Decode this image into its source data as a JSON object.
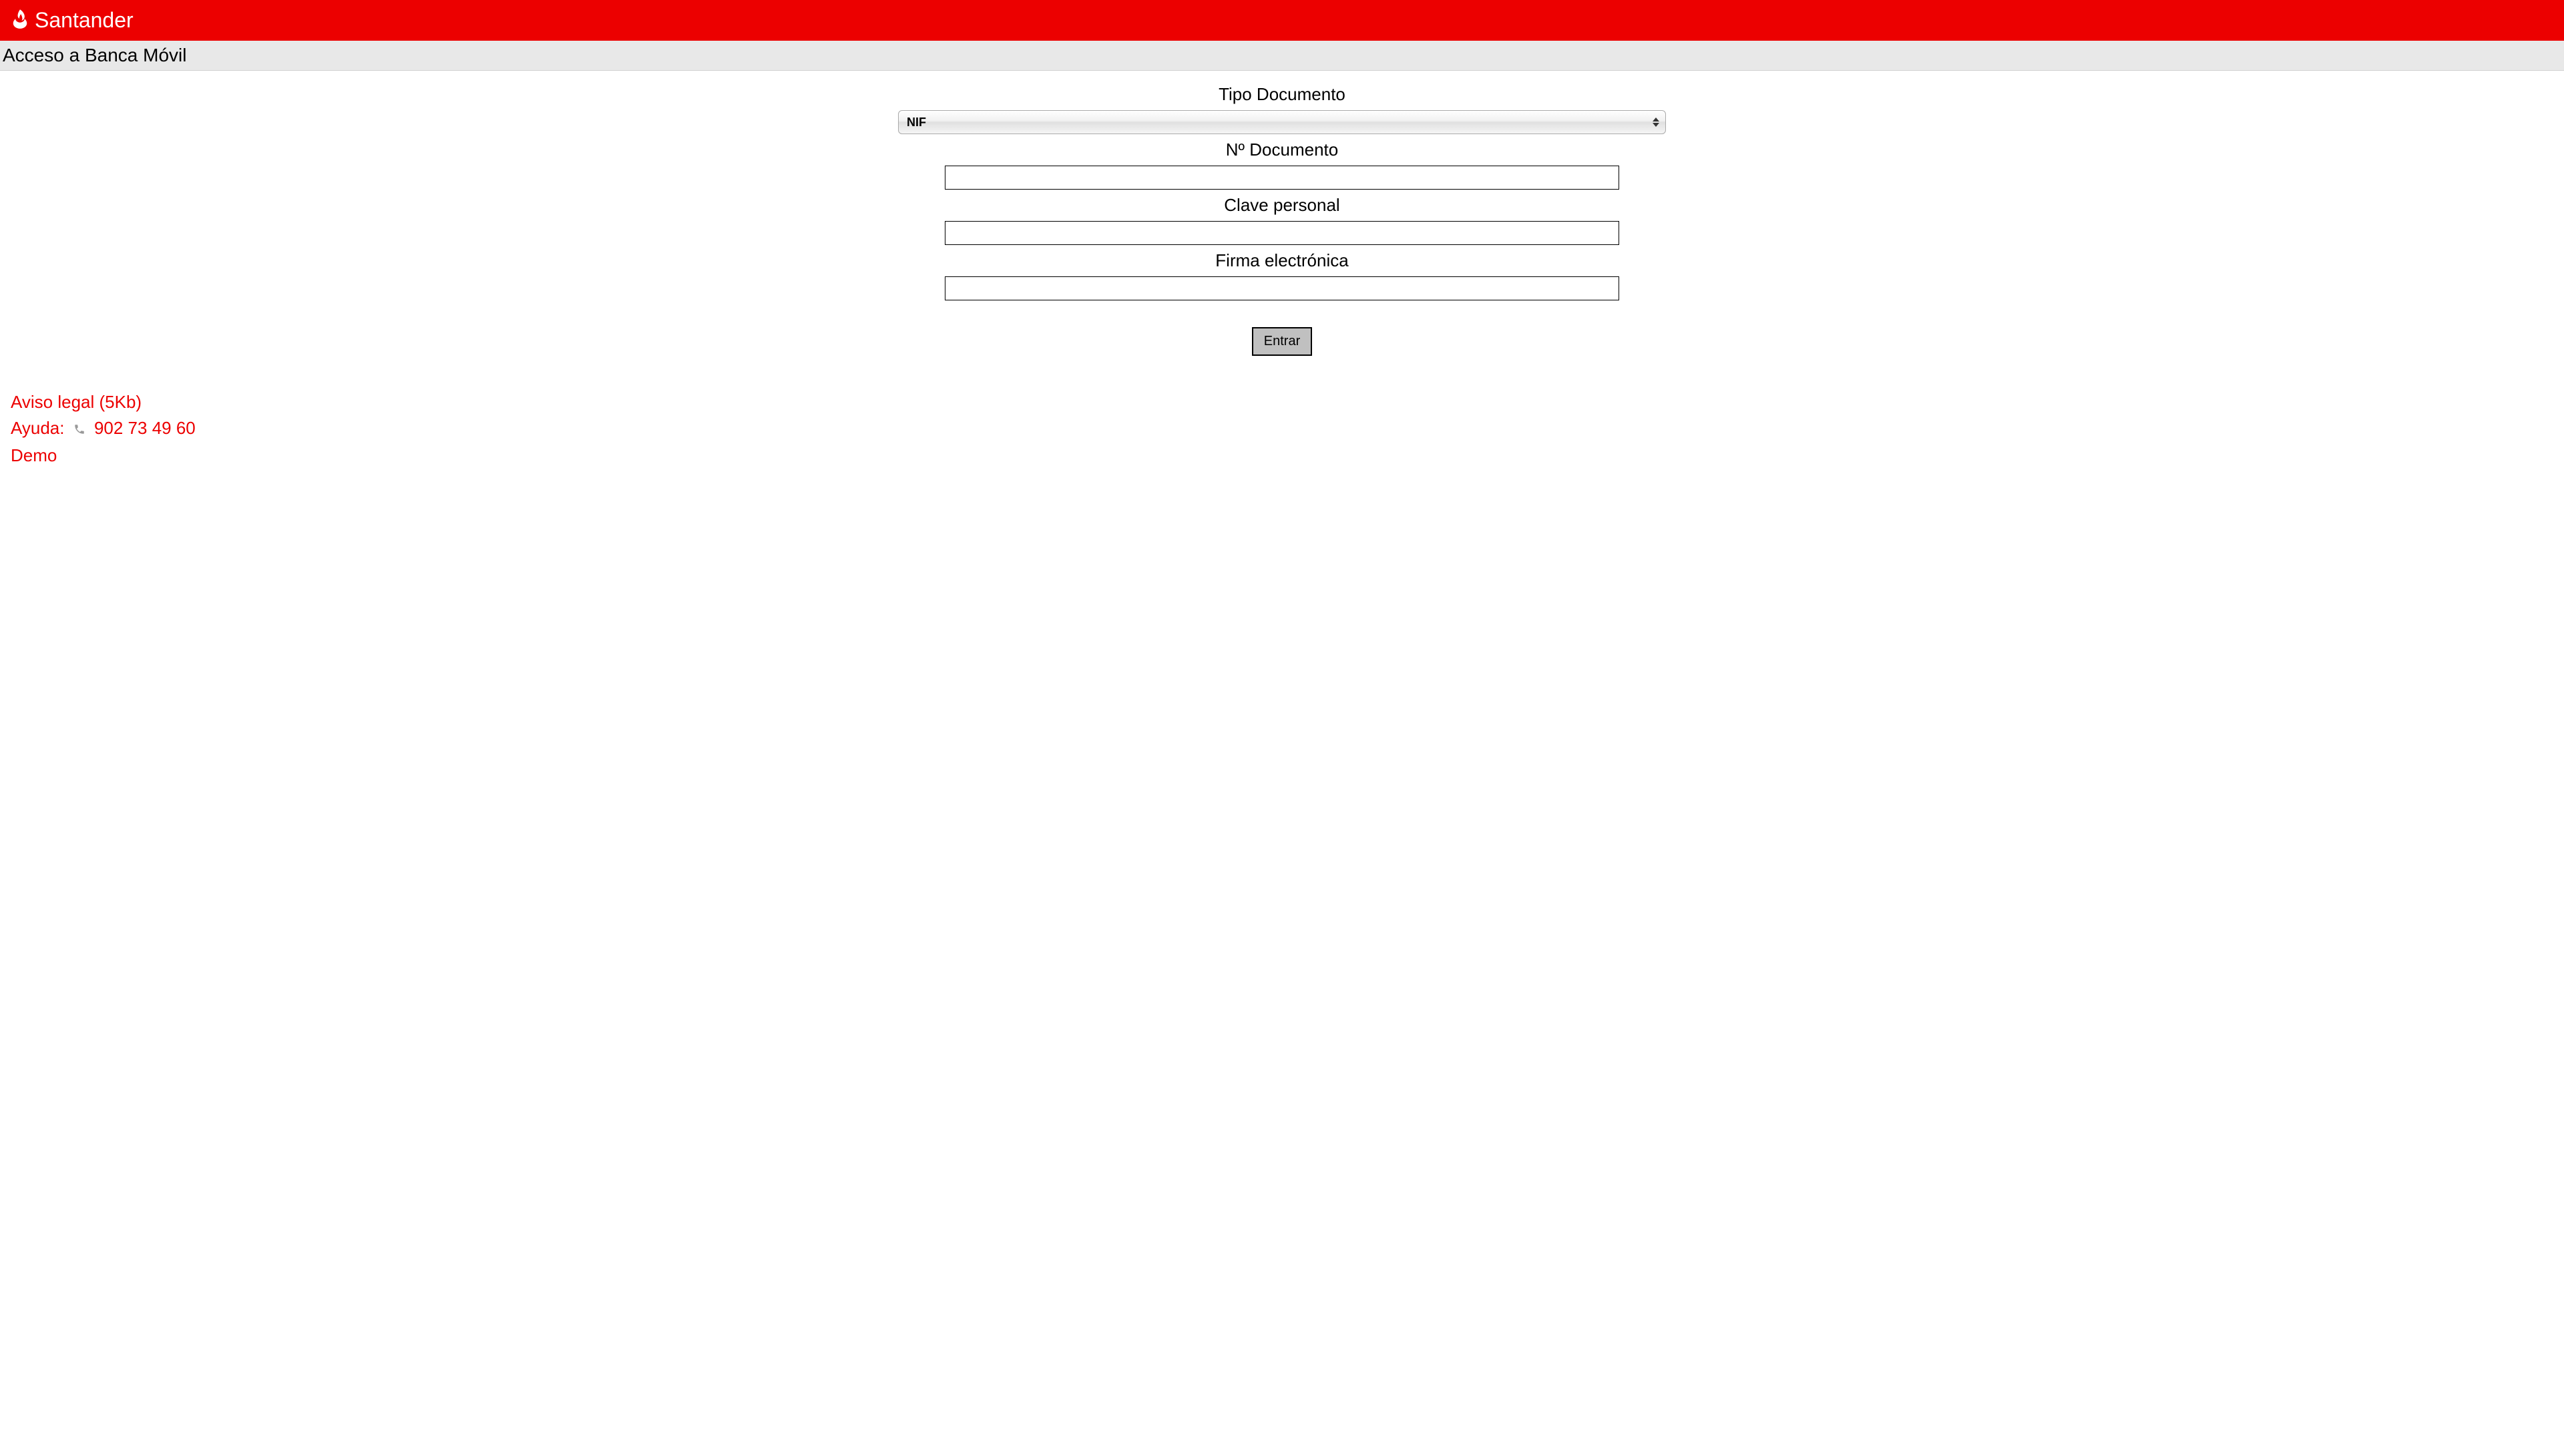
{
  "brand": {
    "name": "Santander"
  },
  "page": {
    "title": "Acceso a Banca Móvil"
  },
  "form": {
    "documentType": {
      "label": "Tipo Documento",
      "selected": "NIF"
    },
    "documentNumber": {
      "label": "Nº Documento",
      "value": ""
    },
    "personalKey": {
      "label": "Clave personal",
      "value": ""
    },
    "electronicSignature": {
      "label": "Firma electrónica",
      "value": ""
    },
    "submit": {
      "label": "Entrar"
    }
  },
  "footer": {
    "legalNotice": "Aviso legal (5Kb)",
    "helpLabel": "Ayuda:",
    "phoneNumber": "902 73 49 60",
    "demo": "Demo"
  }
}
